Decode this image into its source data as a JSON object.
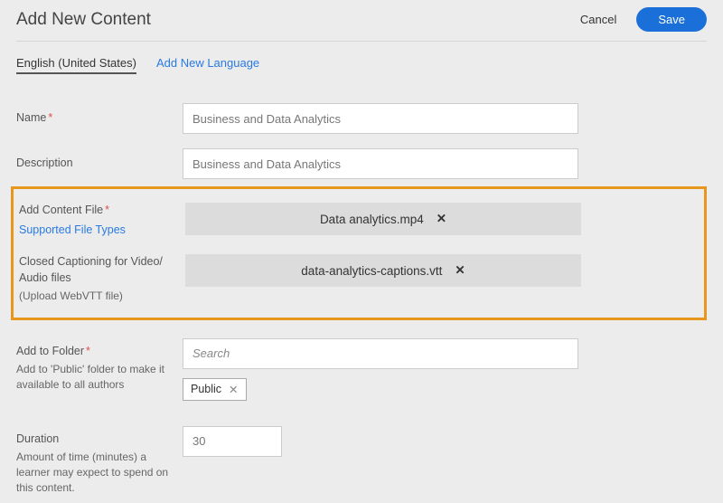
{
  "header": {
    "title": "Add New Content",
    "cancel": "Cancel",
    "save": "Save"
  },
  "lang": {
    "active": "English (United States)",
    "add": "Add New Language"
  },
  "fields": {
    "name": {
      "label": "Name",
      "value": "Business and Data Analytics"
    },
    "description": {
      "label": "Description",
      "value": "Business and Data Analytics"
    },
    "contentFile": {
      "label": "Add Content File",
      "supportedLink": "Supported File Types",
      "filename": "Data analytics.mp4"
    },
    "captions": {
      "label": "Closed Captioning for Video/ Audio files",
      "hint": "(Upload WebVTT file)",
      "filename": "data-analytics-captions.vtt"
    },
    "folder": {
      "label": "Add to Folder",
      "hint": "Add to 'Public' folder to make it available to all authors",
      "searchPlaceholder": "Search",
      "tag": "Public"
    },
    "duration": {
      "label": "Duration",
      "hint": "Amount of time (minutes) a learner may expect to spend on this content.",
      "value": "30"
    }
  },
  "icons": {
    "close": "✕"
  }
}
